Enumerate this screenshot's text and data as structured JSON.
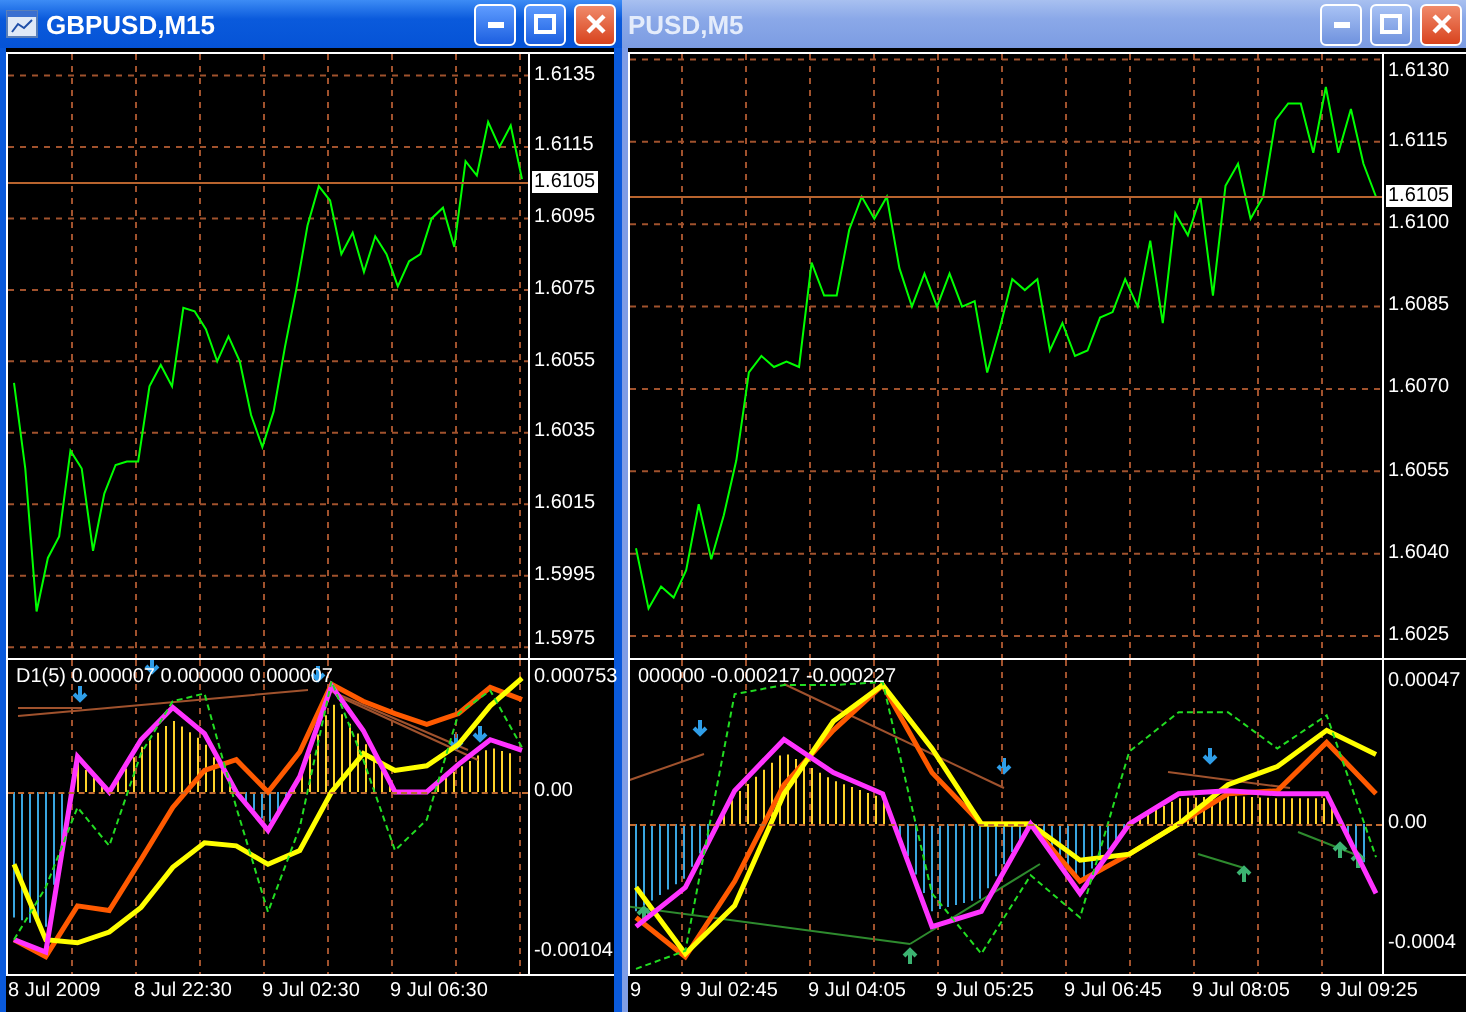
{
  "windows": [
    {
      "title": "GBPUSD,M15",
      "active": true,
      "price_chart": {
        "current_price": "1.6105",
        "chart_data": {
          "type": "line",
          "grid": true,
          "ylim": [
            1.5972,
            1.6141
          ],
          "yticks": [
            {
              "value": 1.6135,
              "label": "1.6135"
            },
            {
              "value": 1.6115,
              "label": "1.6115"
            },
            {
              "value": 1.6095,
              "label": "1.6095"
            },
            {
              "value": 1.6075,
              "label": "1.6075"
            },
            {
              "value": 1.6055,
              "label": "1.6055"
            },
            {
              "value": 1.6035,
              "label": "1.6035"
            },
            {
              "value": 1.6015,
              "label": "1.6015"
            },
            {
              "value": 1.5995,
              "label": "1.5995"
            },
            {
              "value": 1.5975,
              "label": "1.5975"
            }
          ],
          "series": [
            {
              "color": "#00ff00",
              "values": [
                1.6049,
                1.6025,
                1.5985,
                1.6,
                1.6006,
                1.603,
                1.6025,
                1.6002,
                1.6018,
                1.6026,
                1.6027,
                1.6027,
                1.6048,
                1.6054,
                1.6048,
                1.607,
                1.6069,
                1.6064,
                1.6055,
                1.6062,
                1.6055,
                1.604,
                1.6031,
                1.6041,
                1.6059,
                1.6075,
                1.6093,
                1.6104,
                1.61,
                1.6085,
                1.6091,
                1.608,
                1.609,
                1.6085,
                1.6076,
                1.6083,
                1.6085,
                1.6095,
                1.6098,
                1.6087,
                1.6111,
                1.6107,
                1.6122,
                1.6115,
                1.6121,
                1.6106
              ]
            }
          ]
        }
      },
      "indicator": {
        "legend": "D1(5) 0.000007 0.000000 0.000007",
        "chart_data": {
          "type": "line",
          "grid": true,
          "ylim": [
            -0.001183,
            0.000858
          ],
          "yticks": [
            {
              "value": 0.000753,
              "label": "0.000753"
            },
            {
              "value": 0,
              "label": "0.00"
            },
            {
              "value": -0.00104,
              "label": "-0.00104"
            }
          ],
          "series": [
            {
              "color": "#ff33ff",
              "values": [
                -0.00096,
                -0.00104,
                0.00023,
                0,
                0.00034,
                0.00055,
                0.00038,
                0,
                -0.00025,
                0.0001,
                0.00069,
                0.0004,
                0,
                0,
                0.00018,
                0.00034,
                0.00027
              ]
            },
            {
              "color": "#ff5a00",
              "values": [
                -0.00096,
                -0.00107,
                -0.00074,
                -0.00077,
                -0.00044,
                -0.0001,
                0.00014,
                0.00021,
                0,
                0.00026,
                0.0007,
                0.00059,
                0.00051,
                0.00044,
                0.00051,
                0.00068,
                0.0006
              ]
            },
            {
              "color": "#ffff00",
              "values": [
                -0.00047,
                -0.00096,
                -0.00098,
                -0.00091,
                -0.00075,
                -0.00049,
                -0.00033,
                -0.00035,
                -0.00047,
                -0.00038,
                0,
                0.00025,
                0.00014,
                0.00017,
                0.00031,
                0.00056,
                0.00074
              ]
            },
            {
              "color": "#22dd22",
              "line_style": "dashed",
              "values": [
                -0.00096,
                -0.00062,
                -0.0001,
                -0.00035,
                0.00025,
                0.00059,
                0.00064,
                -0.0001,
                -0.00078,
                -0.00023,
                0.00072,
                0.00021,
                -0.00038,
                -0.00018,
                0.00051,
                0.00066,
                0.00029
              ]
            }
          ]
        }
      },
      "x_labels": [
        "8 Jul 2009",
        "8 Jul 22:30",
        "9 Jul 02:30",
        "9 Jul 06:30"
      ]
    },
    {
      "title": "PUSD,M5",
      "active": false,
      "price_chart": {
        "current_price": "1.6105",
        "chart_data": {
          "type": "line",
          "grid": true,
          "ylim": [
            1.6021,
            1.6131
          ],
          "yticks": [
            {
              "value": 1.613,
              "label": "1.6130"
            },
            {
              "value": 1.6115,
              "label": "1.6115"
            },
            {
              "value": 1.61,
              "label": "1.6100"
            },
            {
              "value": 1.6085,
              "label": "1.6085"
            },
            {
              "value": 1.607,
              "label": "1.6070"
            },
            {
              "value": 1.6055,
              "label": "1.6055"
            },
            {
              "value": 1.604,
              "label": "1.6040"
            },
            {
              "value": 1.6025,
              "label": "1.6025"
            }
          ],
          "series": [
            {
              "color": "#00ff00",
              "values": [
                1.6041,
                1.603,
                1.6034,
                1.6032,
                1.6037,
                1.6049,
                1.6039,
                1.6047,
                1.6057,
                1.6073,
                1.6076,
                1.6074,
                1.6075,
                1.6074,
                1.6093,
                1.6087,
                1.6087,
                1.6099,
                1.6105,
                1.6101,
                1.6105,
                1.6092,
                1.6085,
                1.6091,
                1.6085,
                1.6091,
                1.6085,
                1.6086,
                1.6073,
                1.6081,
                1.609,
                1.6088,
                1.609,
                1.6077,
                1.6082,
                1.6076,
                1.6077,
                1.6083,
                1.6084,
                1.609,
                1.6085,
                1.6097,
                1.6082,
                1.6102,
                1.6098,
                1.6105,
                1.6087,
                1.6107,
                1.6111,
                1.6101,
                1.6105,
                1.6119,
                1.6122,
                1.6122,
                1.6113,
                1.6125,
                1.6113,
                1.6121,
                1.6111,
                1.6105
              ]
            }
          ]
        }
      },
      "indicator": {
        "legend": "000000 -0.000217 -0.000227",
        "chart_data": {
          "type": "line",
          "grid": true,
          "ylim": [
            -0.000497,
            0.000543
          ],
          "yticks": [
            {
              "value": 0.00047,
              "label": "0.00047"
            },
            {
              "value": 0,
              "label": "0.00"
            },
            {
              "value": -0.0004,
              "label": "-0.0004"
            }
          ],
          "series": [
            {
              "color": "#ff33ff",
              "values": [
                -0.00034,
                -0.00021,
                0.00011,
                0.00028,
                0.00017,
                0.0001,
                -0.00034,
                -0.00029,
                0,
                -0.00023,
                0,
                0.0001,
                0.00011,
                0.0001,
                0.0001,
                -0.00023
              ]
            },
            {
              "color": "#ff5a00",
              "values": [
                -0.00031,
                -0.00044,
                -0.00019,
                0.00013,
                0.00031,
                0.00046,
                0.00017,
                0,
                0,
                -0.00019,
                -0.0001,
                0,
                0.0001,
                0.00011,
                0.00027,
                0.0001
              ]
            },
            {
              "color": "#ffff00",
              "values": [
                -0.00021,
                -0.00043,
                -0.00027,
                0.0001,
                0.00034,
                0.00046,
                0.00025,
                0,
                0,
                -0.00012,
                -0.0001,
                0,
                0.00013,
                0.00019,
                0.00031,
                0.00023
              ]
            },
            {
              "color": "#22dd22",
              "line_style": "dashed",
              "values": [
                -0.00048,
                -0.00042,
                0.00043,
                0.00046,
                0.00046,
                0.00047,
                -0.00023,
                -0.00043,
                -0.00017,
                -0.00031,
                0.00024,
                0.00037,
                0.00037,
                0.00025,
                0.00036,
                -0.00011
              ]
            }
          ]
        }
      },
      "x_labels": [
        "9",
        "9 Jul 02:45",
        "9 Jul 04:05",
        "9 Jul 05:25",
        "9 Jul 06:45",
        "9 Jul 08:05",
        "9 Jul 09:25"
      ]
    }
  ]
}
